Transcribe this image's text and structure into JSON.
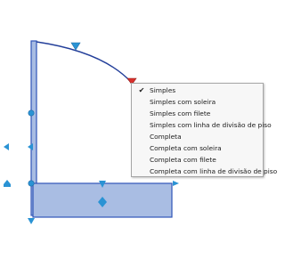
{
  "context_menu": {
    "items": [
      {
        "label": "Simples",
        "checked": true
      },
      {
        "label": "Simples com soleira",
        "checked": false
      },
      {
        "label": "Simples com filete",
        "checked": false
      },
      {
        "label": "Simples com linha de divisão de piso",
        "checked": false
      },
      {
        "label": "Completa",
        "checked": false
      },
      {
        "label": "Completa com soleira",
        "checked": false
      },
      {
        "label": "Completa com filete",
        "checked": false
      },
      {
        "label": "Completa com linha de divisão de piso",
        "checked": false
      }
    ],
    "check_icon": "checkmark-icon"
  },
  "colors": {
    "wall_fill": "#a9bde3",
    "wall_stroke": "#2f55b8",
    "grip": "#2a93d4",
    "grip_selected": "#d9302c",
    "arc": "#233f9a"
  }
}
